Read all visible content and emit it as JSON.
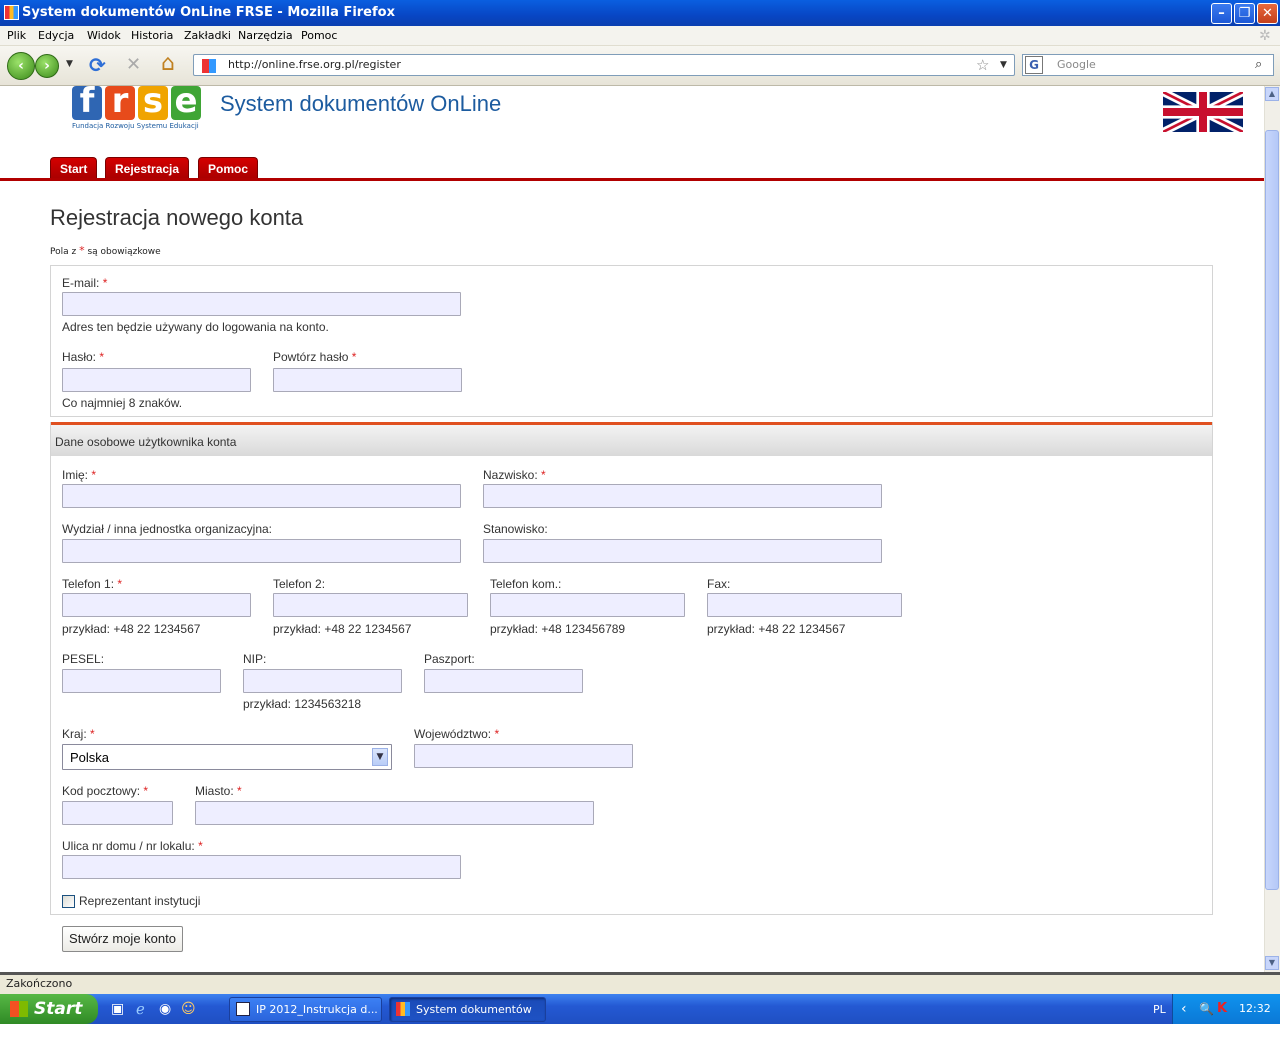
{
  "window": {
    "title": "System dokumentów OnLine FRSE - Mozilla Firefox",
    "min": "–",
    "max": "❐",
    "close": "✕"
  },
  "menu": [
    "Plik",
    "Edycja",
    "Widok",
    "Historia",
    "Zakładki",
    "Narzędzia",
    "Pomoc"
  ],
  "nav": {
    "back": "‹",
    "forward": "›",
    "reload": "⟳",
    "stop": "✕",
    "home": "⌂",
    "url": "http://online.frse.org.pl/register",
    "search_placeholder": "Google"
  },
  "site": {
    "logo": [
      "f",
      "r",
      "s",
      "e"
    ],
    "logo_sub": "Fundacja Rozwoju Systemu Edukacji",
    "title": "System dokumentów OnLine"
  },
  "tabs": [
    "Start",
    "Rejestracja",
    "Pomoc"
  ],
  "page": {
    "heading": "Rejestracja nowego konta",
    "required_note_pre": "Pola z",
    "required_star": "*",
    "required_note_post": "są obowiązkowe"
  },
  "form": {
    "email_label": "E-mail:",
    "email_hint": "Adres ten będzie używany do logowania na konto.",
    "password_label": "Hasło:",
    "password2_label": "Powtórz hasło",
    "password_hint": "Co najmniej 8 znaków.",
    "section_title": "Dane osobowe użytkownika konta",
    "first_name_label": "Imię:",
    "last_name_label": "Nazwisko:",
    "department_label": "Wydział / inna jednostka organizacyjna:",
    "position_label": "Stanowisko:",
    "phone1_label": "Telefon 1:",
    "phone2_label": "Telefon 2:",
    "mobile_label": "Telefon kom.:",
    "fax_label": "Fax:",
    "phone1_hint": "przykład:  +48 22 1234567",
    "phone2_hint": "przykład:  +48 22 1234567",
    "mobile_hint": "przykład:  +48 123456789",
    "fax_hint": "przykład:  +48 22 1234567",
    "pesel_label": "PESEL:",
    "nip_label": "NIP:",
    "nip_hint": "przykład:  1234563218",
    "passport_label": "Paszport:",
    "country_label": "Kraj:",
    "country_value": "Polska",
    "province_label": "Województwo:",
    "postcode_label": "Kod pocztowy:",
    "city_label": "Miasto:",
    "street_label": "Ulica nr domu / nr lokalu:",
    "institution_label": "Reprezentant instytucji",
    "submit": "Stwórz moje konto",
    "star": "*"
  },
  "status": "Zakończono",
  "taskbar": {
    "start": "Start",
    "tasks": [
      "IP 2012_Instrukcja d...",
      "System dokumentów ..."
    ],
    "lang": "PL",
    "clock": "12:32"
  },
  "colors": {
    "accent_red": "#b10000",
    "title_blue": "#1c5b9f",
    "input_bg": "#eeeeff",
    "section_border": "#e05020"
  },
  "icons": [
    "firefox-icon",
    "back-icon",
    "forward-icon",
    "reload-icon",
    "stop-icon",
    "home-icon",
    "star-icon",
    "uk-flag-icon",
    "dropdown-arrow-icon",
    "windows-logo-icon"
  ]
}
